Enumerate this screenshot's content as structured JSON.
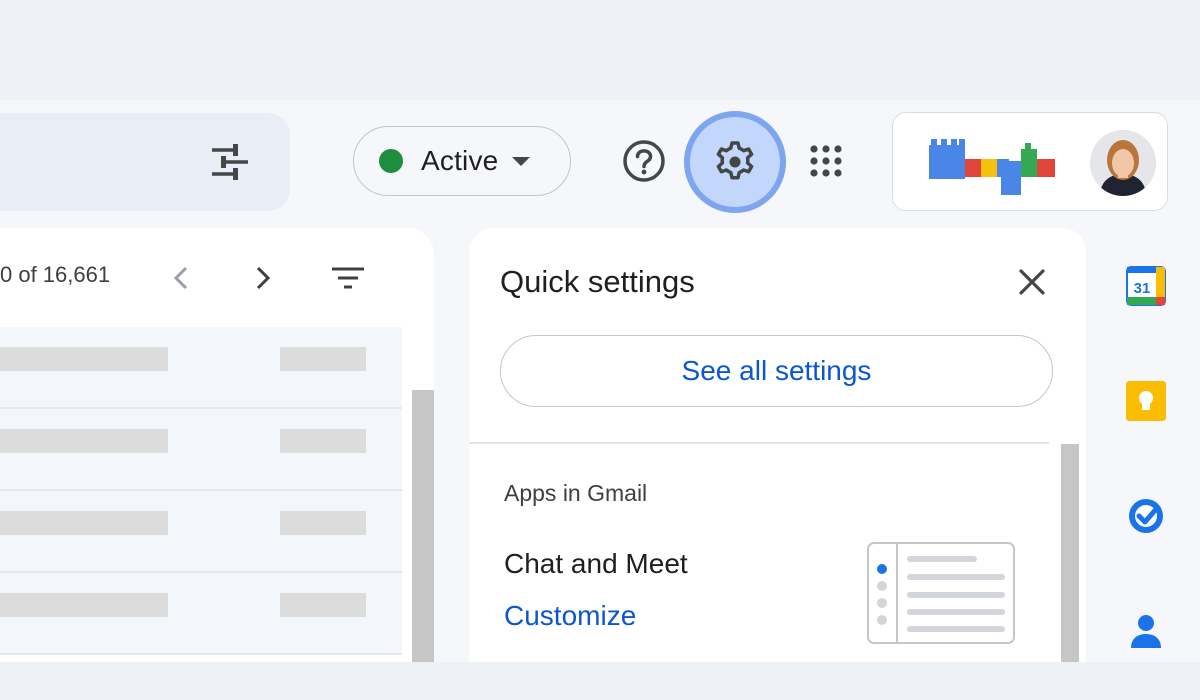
{
  "header": {
    "status": {
      "label": "Active",
      "color": "#1e8e3e"
    },
    "icons": {
      "filter_options": "tune-icon",
      "help": "help-icon",
      "settings": "gear-icon",
      "apps": "apps-grid-icon"
    }
  },
  "mail_list": {
    "pager_text": "0 of 16,661",
    "prev_icon": "chevron-left-icon",
    "next_icon": "chevron-right-icon",
    "filter_icon": "filter-icon"
  },
  "quick_settings": {
    "title": "Quick settings",
    "see_all_label": "See all settings",
    "section_title": "Apps in Gmail",
    "item_label": "Chat and Meet",
    "customize_label": "Customize"
  },
  "side_panel": {
    "calendar_label": "31",
    "icons": [
      "calendar-icon",
      "keep-icon",
      "tasks-icon",
      "contacts-icon"
    ]
  },
  "colors": {
    "accent_blue": "#0b57d0",
    "settings_highlight": "#c2d7fb",
    "active_green": "#1e8e3e"
  }
}
